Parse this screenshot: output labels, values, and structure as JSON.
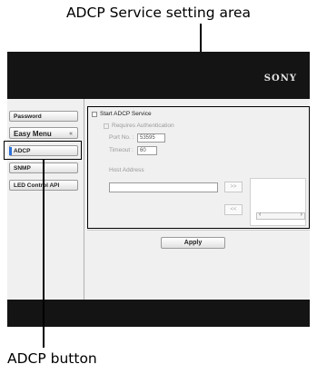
{
  "captions": {
    "top": "ADCP Service setting area",
    "bottom": "ADCP button"
  },
  "header": {
    "logo": "SONY"
  },
  "nav": {
    "items": [
      {
        "label": "Password",
        "name": "nav-password-button"
      },
      {
        "label": "Easy Menu",
        "name": "nav-easy-menu-button"
      },
      {
        "label": "ADCP",
        "name": "nav-adcp-button"
      },
      {
        "label": "SNMP",
        "name": "nav-snmp-button"
      },
      {
        "label": "LED Control API",
        "name": "nav-led-control-api-button"
      }
    ],
    "easy_menu_chevron": "«"
  },
  "adcp": {
    "start_label": "Start ADCP Service",
    "requires_auth_label": "Requires Authentication",
    "port_label": "Port No. :",
    "port_value": "53595",
    "timeout_label": "Timeout :",
    "timeout_value": "60",
    "host_label": "Host Address",
    "add_button": ">>",
    "remove_button": "<<",
    "scroll_left": "‹",
    "scroll_right": "›"
  },
  "actions": {
    "apply_label": "Apply"
  },
  "colors": {
    "header": "#141414",
    "active_marker": "#2d6fd8",
    "background": "#f0f0f0"
  }
}
